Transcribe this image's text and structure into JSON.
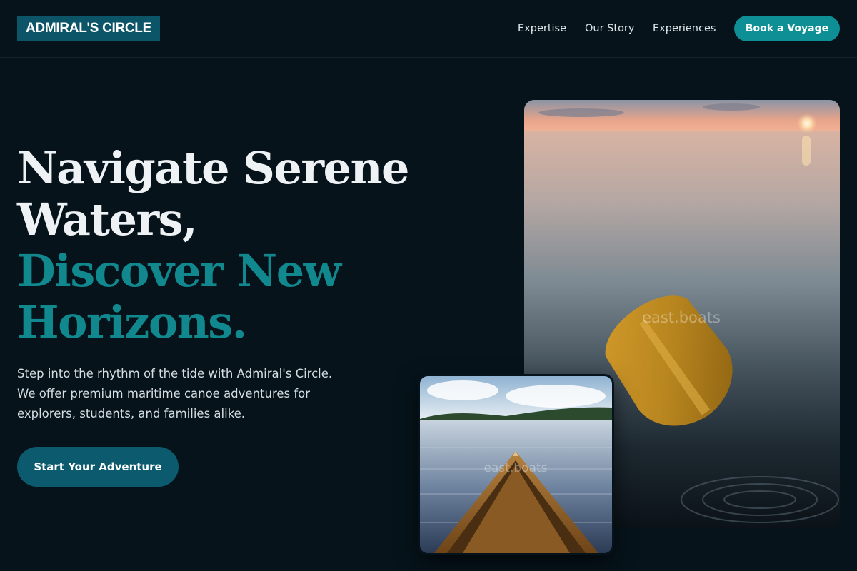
{
  "header": {
    "logo": "ADMIRAL'S CIRCLE",
    "nav": [
      "Expertise",
      "Our Story",
      "Experiences"
    ],
    "cta": "Book a Voyage"
  },
  "hero": {
    "headline_lines": [
      "Navigate Serene",
      "Waters,"
    ],
    "headline_accent_lines": [
      "Discover New",
      "Horizons."
    ],
    "lead": "Step into the rhythm of the tide with Admiral's Circle. We offer premium maritime canoe adventures for explorers, students, and families alike.",
    "cta": "Start Your Adventure"
  },
  "images": {
    "main_watermark": "east.boats",
    "small_watermark": "east.boats"
  },
  "colors": {
    "background": "#06131b",
    "accent_teal": "#0e8e95",
    "cta_dark_teal": "#0b5a6d"
  }
}
